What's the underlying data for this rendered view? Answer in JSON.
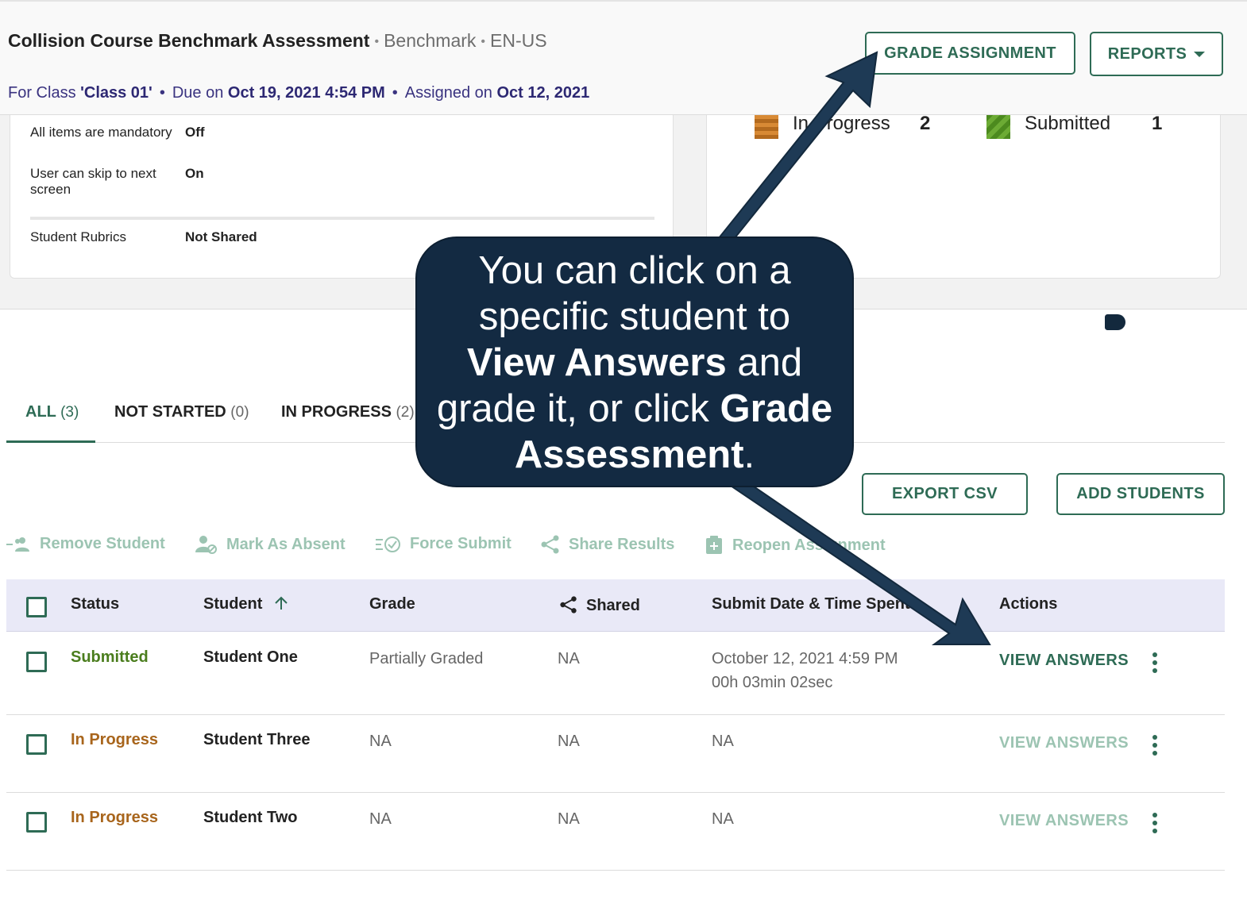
{
  "header": {
    "title": "Collision Course Benchmark Assessment",
    "type": "Benchmark",
    "locale": "EN-US",
    "class_prefix": "For Class ",
    "class_name": "'Class 01'",
    "due_prefix": "Due on ",
    "due_date": "Oct 19, 2021 4:54 PM",
    "assigned_prefix": "Assigned on ",
    "assigned_date": "Oct 12, 2021",
    "grade_button": "GRADE ASSIGNMENT",
    "reports_button": "REPORTS"
  },
  "settings": [
    {
      "label": "All items are mandatory",
      "value": "Off"
    },
    {
      "label": "User can skip to next screen",
      "value": "On"
    },
    {
      "label": "Student Rubrics",
      "value": "Not Shared"
    }
  ],
  "legend": {
    "in_progress_label": "In Progress",
    "in_progress_count": "2",
    "submitted_label": "Submitted",
    "submitted_count": "1",
    "colors": {
      "in_progress": "#b36a1e",
      "submitted": "#4c8a1e"
    }
  },
  "tabs": [
    {
      "label": "ALL",
      "count": "(3)"
    },
    {
      "label": "NOT STARTED",
      "count": "(0)"
    },
    {
      "label": "IN PROGRESS",
      "count": "(2)"
    }
  ],
  "buttons": {
    "export": "EXPORT CSV",
    "add_students": "ADD STUDENTS"
  },
  "toolbar": {
    "remove": "Remove Student",
    "absent": "Mark As Absent",
    "force": "Force Submit",
    "share": "Share Results",
    "reopen": "Reopen Assignment"
  },
  "table": {
    "headers": {
      "status": "Status",
      "student": "Student",
      "grade": "Grade",
      "shared": "Shared",
      "submit": "Submit Date & Time Spent",
      "actions": "Actions"
    },
    "rows": [
      {
        "status": "Submitted",
        "student": "Student One",
        "grade": "Partially Graded",
        "shared": "NA",
        "submit": "October 12, 2021 4:59 PM",
        "time_spent": "00h 03min 02sec",
        "action": "VIEW ANSWERS"
      },
      {
        "status": "In Progress",
        "student": "Student Three",
        "grade": "NA",
        "shared": "NA",
        "submit": "NA",
        "time_spent": "",
        "action": "VIEW ANSWERS"
      },
      {
        "status": "In Progress",
        "student": "Student Two",
        "grade": "NA",
        "shared": "NA",
        "submit": "NA",
        "time_spent": "",
        "action": "VIEW ANSWERS"
      }
    ]
  },
  "callout": {
    "line1": "You can click on a",
    "line2": "specific student to",
    "bold1": "View Answers",
    "mid": " and",
    "line4": "grade it, or click ",
    "bold2": "Grade",
    "bold3": "Assessment",
    "end": "."
  },
  "theme": {
    "accent": "#2e6b55",
    "callout_bg": "#132a42",
    "header_text": "#3a3380"
  }
}
